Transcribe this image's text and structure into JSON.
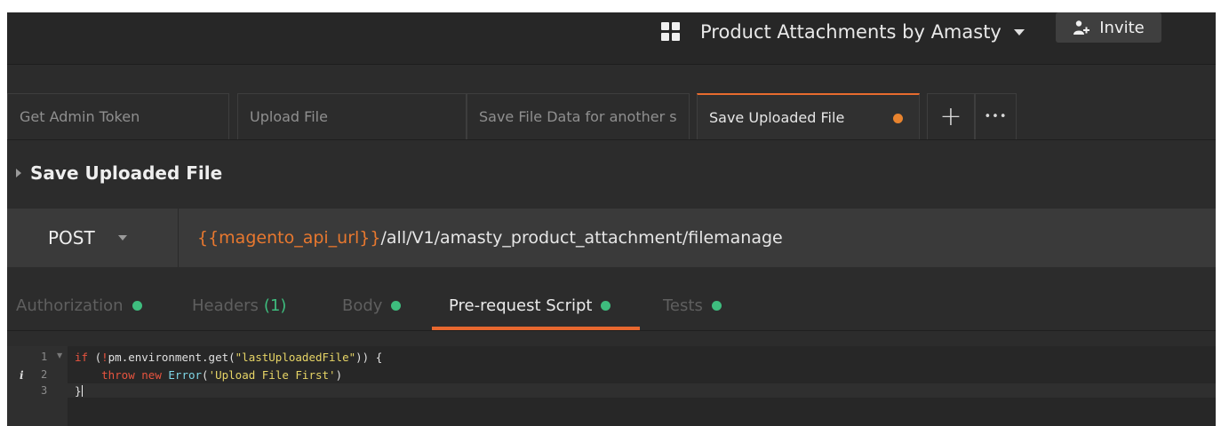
{
  "workspace": {
    "name": "Product Attachments by Amasty",
    "icon": "grid-icon"
  },
  "invite_label": "Invite",
  "tabs": [
    {
      "label": "Get Admin Token"
    },
    {
      "label": "Upload File"
    },
    {
      "label": "Save File Data for another s"
    },
    {
      "label": "Save Uploaded File"
    }
  ],
  "new_tab": "+",
  "more_tabs": "•••",
  "request": {
    "name": "Save Uploaded File",
    "method": "POST",
    "url_var": "{{magento_api_url}}",
    "url_path": "/all/V1/amasty_product_attachment/filemanage"
  },
  "subtabs": {
    "authorization": "Authorization",
    "headers": "Headers",
    "headers_count": "(1)",
    "body": "Body",
    "prerequest": "Pre-request Script",
    "tests": "Tests"
  },
  "editor": {
    "line_numbers": [
      "1",
      "2",
      "3"
    ],
    "info_marker": "i",
    "lines": [
      {
        "kw": "if",
        "p1": " (",
        "p2": "!",
        "p3": "pm.environment.get(",
        "s1": "\"lastUploadedFile\"",
        "p4": ")) {"
      },
      {
        "indent": "    ",
        "kw1": "throw",
        "kw2": "new",
        "fn": "Error",
        "p1": "(",
        "s1": "'Upload File First'",
        "p2": ")"
      },
      {
        "p1": "}"
      }
    ]
  },
  "colors": {
    "accent": "#e8682f",
    "green_dot": "#3ebd7e",
    "unsaved_dot": "#e8832e"
  }
}
